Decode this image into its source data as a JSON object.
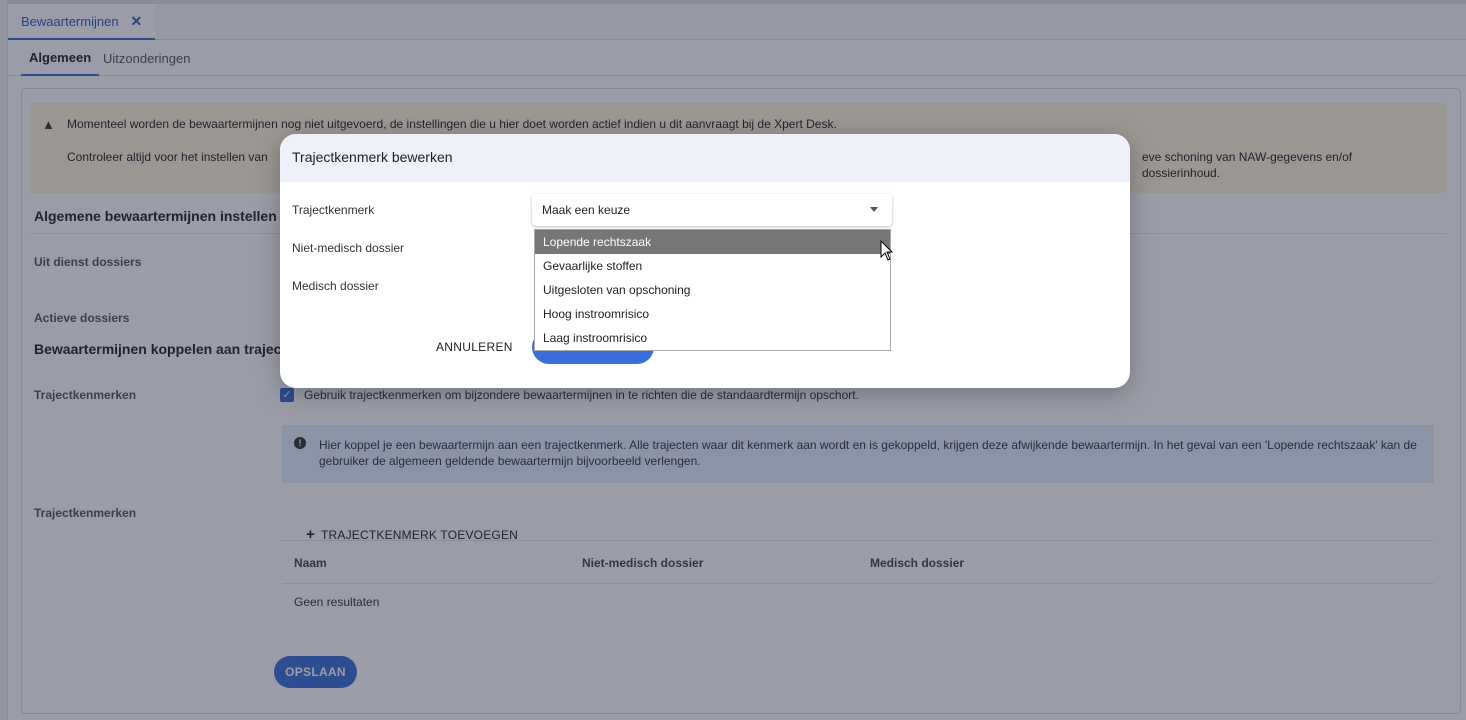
{
  "doc_tab": {
    "label": "Bewaartermijnen",
    "close": "✕"
  },
  "sub_tabs": [
    {
      "label": "Algemeen"
    },
    {
      "label": "Uitzonderingen"
    }
  ],
  "warning": {
    "line1": "Momenteel worden de bewaartermijnen nog niet uitgevoerd, de instellingen die u hier doet worden actief indien u dit aanvraagt bij de Xpert Desk.",
    "line2_start": "Controleer altijd voor het instellen van",
    "line2_end": "eve schoning van NAW-gegevens en/of dossierinhoud."
  },
  "section": {
    "general_title": "Algemene bewaartermijnen instellen",
    "uit_dienst": "Uit dienst dossiers",
    "actieve": "Actieve dossiers",
    "koppelen_title": "Bewaartermijnen koppelen aan trajectk",
    "trajectkenmerken_label": "Trajectkenmerken",
    "trajectkenmerken_label2": "Trajectkenmerken"
  },
  "checkbox_label": "Gebruik trajectkenmerken om bijzondere bewaartermijnen in te richten die de standaardtermijn opschort.",
  "info_text": "Hier koppel je een bewaartermijn aan een trajectkenmerk. Alle trajecten waar dit kenmerk aan wordt en is gekoppeld, krijgen deze afwijkende bewaartermijn. In het geval van een 'Lopende rechtszaak' kan de gebruiker de algemeen geldende bewaartermijn bijvoorbeeld verlengen.",
  "table": {
    "add_label": "TRAJECTKENMERK TOEVOEGEN",
    "headers": [
      "Naam",
      "Niet-medisch dossier",
      "Medisch dossier"
    ],
    "empty": "Geen resultaten"
  },
  "save_label": "OPSLAAN",
  "modal": {
    "title": "Trajectkenmerk bewerken",
    "labels": [
      "Trajectkenmerk",
      "Niet-medisch dossier",
      "Medisch dossier"
    ],
    "select_value": "Maak een keuze",
    "cancel": "ANNULEREN",
    "options": [
      "Lopende rechtszaak",
      "Gevaarlijke stoffen",
      "Uitgesloten van opschoning",
      "Hoog instroomrisico",
      "Laag instroomrisico"
    ],
    "selected_index": 0
  },
  "colors": {
    "accent": "#3a6fd8",
    "warning_bg": "#fff5d9",
    "info_bg": "#e3f1fb"
  }
}
